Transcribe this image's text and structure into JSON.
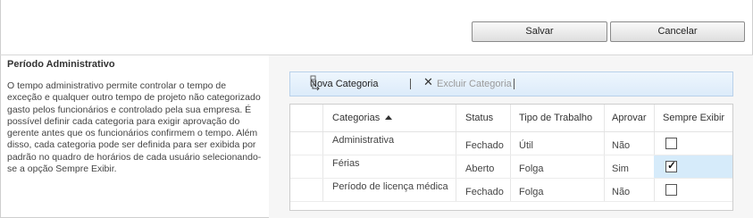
{
  "buttons": {
    "save": "Salvar",
    "cancel": "Cancelar"
  },
  "section": {
    "title": "Período Administrativo",
    "description": "O tempo administrativo permite controlar o tempo de exceção e qualquer outro tempo de projeto não categorizado gasto pelos funcionários e controlado pela sua empresa. É possível definir cada categoria para exigir aprovação do gerente antes que os funcionários confirmem o tempo. Além disso, cada categoria pode ser definida para ser exibida por padrão no quadro de horários de cada usuário selecionando-se a opção Sempre Exibir."
  },
  "toolbar": {
    "new_category": "Nova Categoria",
    "delete_category": "Excluir Categoria"
  },
  "grid": {
    "columns": [
      "Categorias",
      "Status",
      "Tipo de Trabalho",
      "Aprovar",
      "Sempre Exibir"
    ],
    "sort": "ascending",
    "rows": [
      {
        "category": "Administrativa",
        "status": "Fechado",
        "work_type": "Útil",
        "approve": "Não",
        "always_show": false
      },
      {
        "category": "Férias",
        "status": "Aberto",
        "work_type": "Folga",
        "approve": "Sim",
        "always_show": true
      },
      {
        "category": "Período de licença médica",
        "status": "Fechado",
        "work_type": "Folga",
        "approve": "Não",
        "always_show": false
      }
    ]
  }
}
